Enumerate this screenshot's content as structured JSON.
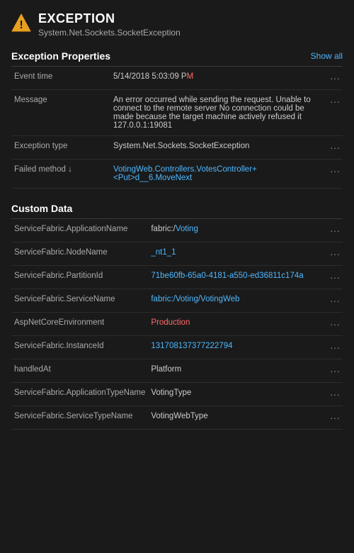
{
  "header": {
    "icon_label": "warning-triangle",
    "title": "EXCEPTION",
    "subtitle": "System.Net.Sockets.SocketException"
  },
  "exception_properties_section": {
    "title": "Exception Properties",
    "show_all_label": "Show all",
    "rows": [
      {
        "name": "Event time",
        "value_parts": [
          {
            "text": "5/14/2018 5:03:09 P",
            "highlight": false
          },
          {
            "text": "M",
            "highlight": true
          }
        ],
        "value_plain": "5/14/2018 5:03:09 PM"
      },
      {
        "name": "Message",
        "value_parts": [
          {
            "text": "An error occurred while sending the request. Unable to connect to the remote server No connection could be made because the target machine actively refused it 127.0.0.1:19081",
            "highlight": false
          }
        ],
        "value_plain": "An error occurred while sending the request. Unable to connect to the remote server No connection could be made because the target machine actively refused it 127.0.0.1:19081"
      },
      {
        "name": "Exception type",
        "value_parts": [
          {
            "text": "System.Net.Sockets.SocketException",
            "highlight": false
          }
        ],
        "value_plain": "System.Net.Sockets.SocketException"
      },
      {
        "name": "Failed method",
        "value_parts": [
          {
            "text": "VotingWeb.Controllers.VotesController+<Put>d__6.MoveNext",
            "highlight": false,
            "link": true
          }
        ],
        "value_plain": "VotingWeb.Controllers.VotesController+<Put>d__6.MoveNext"
      }
    ]
  },
  "custom_data_section": {
    "title": "Custom Data",
    "rows": [
      {
        "name": "ServiceFabric.ApplicationName",
        "value": "fabric:/Voting",
        "value_link": true,
        "value_highlight_end": "Voting"
      },
      {
        "name": "ServiceFabric.NodeName",
        "value": "_nt1_1",
        "value_link": true
      },
      {
        "name": "ServiceFabric.PartitionId",
        "value": "71be60fb-65a0-4181-a550-ed36811c174a",
        "value_link": true
      },
      {
        "name": "ServiceFabric.ServiceName",
        "value": "fabric:/Voting/VotingWeb",
        "value_link": true
      },
      {
        "name": "AspNetCoreEnvironment",
        "value": "Production",
        "value_red": true
      },
      {
        "name": "ServiceFabric.InstanceId",
        "value": "131708137377222794",
        "value_link": true
      },
      {
        "name": "handledAt",
        "value": "Platform",
        "value_plain": true
      },
      {
        "name": "ServiceFabric.ApplicationTypeName",
        "value": "VotingType",
        "value_plain": true
      },
      {
        "name": "ServiceFabric.ServiceTypeName",
        "value": "VotingWebType",
        "value_plain": true
      }
    ]
  },
  "actions": {
    "more_options_label": "···"
  }
}
